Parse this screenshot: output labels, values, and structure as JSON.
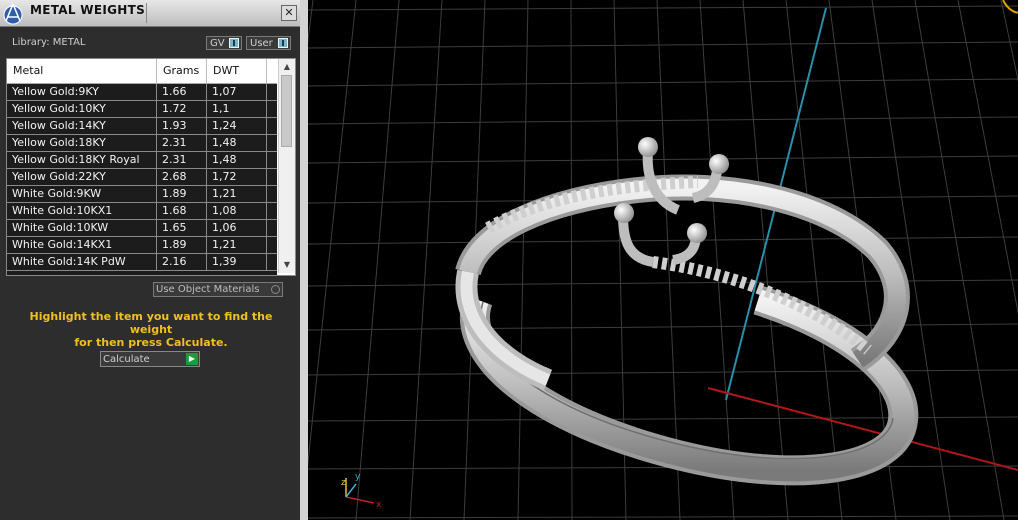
{
  "panel": {
    "title": "METAL WEIGHTS",
    "close_glyph": "✕",
    "library_label": "Library: METAL",
    "toggles": [
      {
        "label": "GV"
      },
      {
        "label": "User"
      }
    ],
    "table": {
      "columns": [
        "Metal",
        "Grams",
        "DWT"
      ],
      "rows": [
        {
          "metal": "Yellow Gold:9KY",
          "grams": "1.66",
          "dwt": "1,07"
        },
        {
          "metal": "Yellow Gold:10KY",
          "grams": "1.72",
          "dwt": "1,1"
        },
        {
          "metal": "Yellow Gold:14KY",
          "grams": "1.93",
          "dwt": "1,24"
        },
        {
          "metal": "Yellow Gold:18KY",
          "grams": "2.31",
          "dwt": "1,48"
        },
        {
          "metal": "Yellow Gold:18KY Royal",
          "grams": "2.31",
          "dwt": "1,48"
        },
        {
          "metal": "Yellow Gold:22KY",
          "grams": "2.68",
          "dwt": "1,72"
        },
        {
          "metal": "White Gold:9KW",
          "grams": "1.89",
          "dwt": "1,21"
        },
        {
          "metal": "White Gold:10KX1",
          "grams": "1.68",
          "dwt": "1,08"
        },
        {
          "metal": "White Gold:10KW",
          "grams": "1.65",
          "dwt": "1,06"
        },
        {
          "metal": "White Gold:14KX1",
          "grams": "1.89",
          "dwt": "1,21"
        },
        {
          "metal": "White Gold:14K PdW",
          "grams": "2.16",
          "dwt": "1,39"
        }
      ]
    },
    "use_object_materials": "Use Object Materials",
    "hint_line1": "Highlight the item you want to find the weight",
    "hint_line2": "for then press Calculate.",
    "calculate_label": "Calculate"
  },
  "viewport": {
    "axis_labels": {
      "x": "x",
      "y": "y",
      "z": "z"
    },
    "colors": {
      "grid": "#3d3d3d",
      "x_axis": "#b01818",
      "y_axis": "#2a8fa8",
      "model": "#d9d9d9",
      "hint": "#f0c020"
    },
    "icons": [
      "app-logo-icon",
      "close-icon",
      "scroll-up-icon",
      "scroll-down-icon",
      "calculate-go-icon",
      "axis-triad-icon"
    ]
  }
}
